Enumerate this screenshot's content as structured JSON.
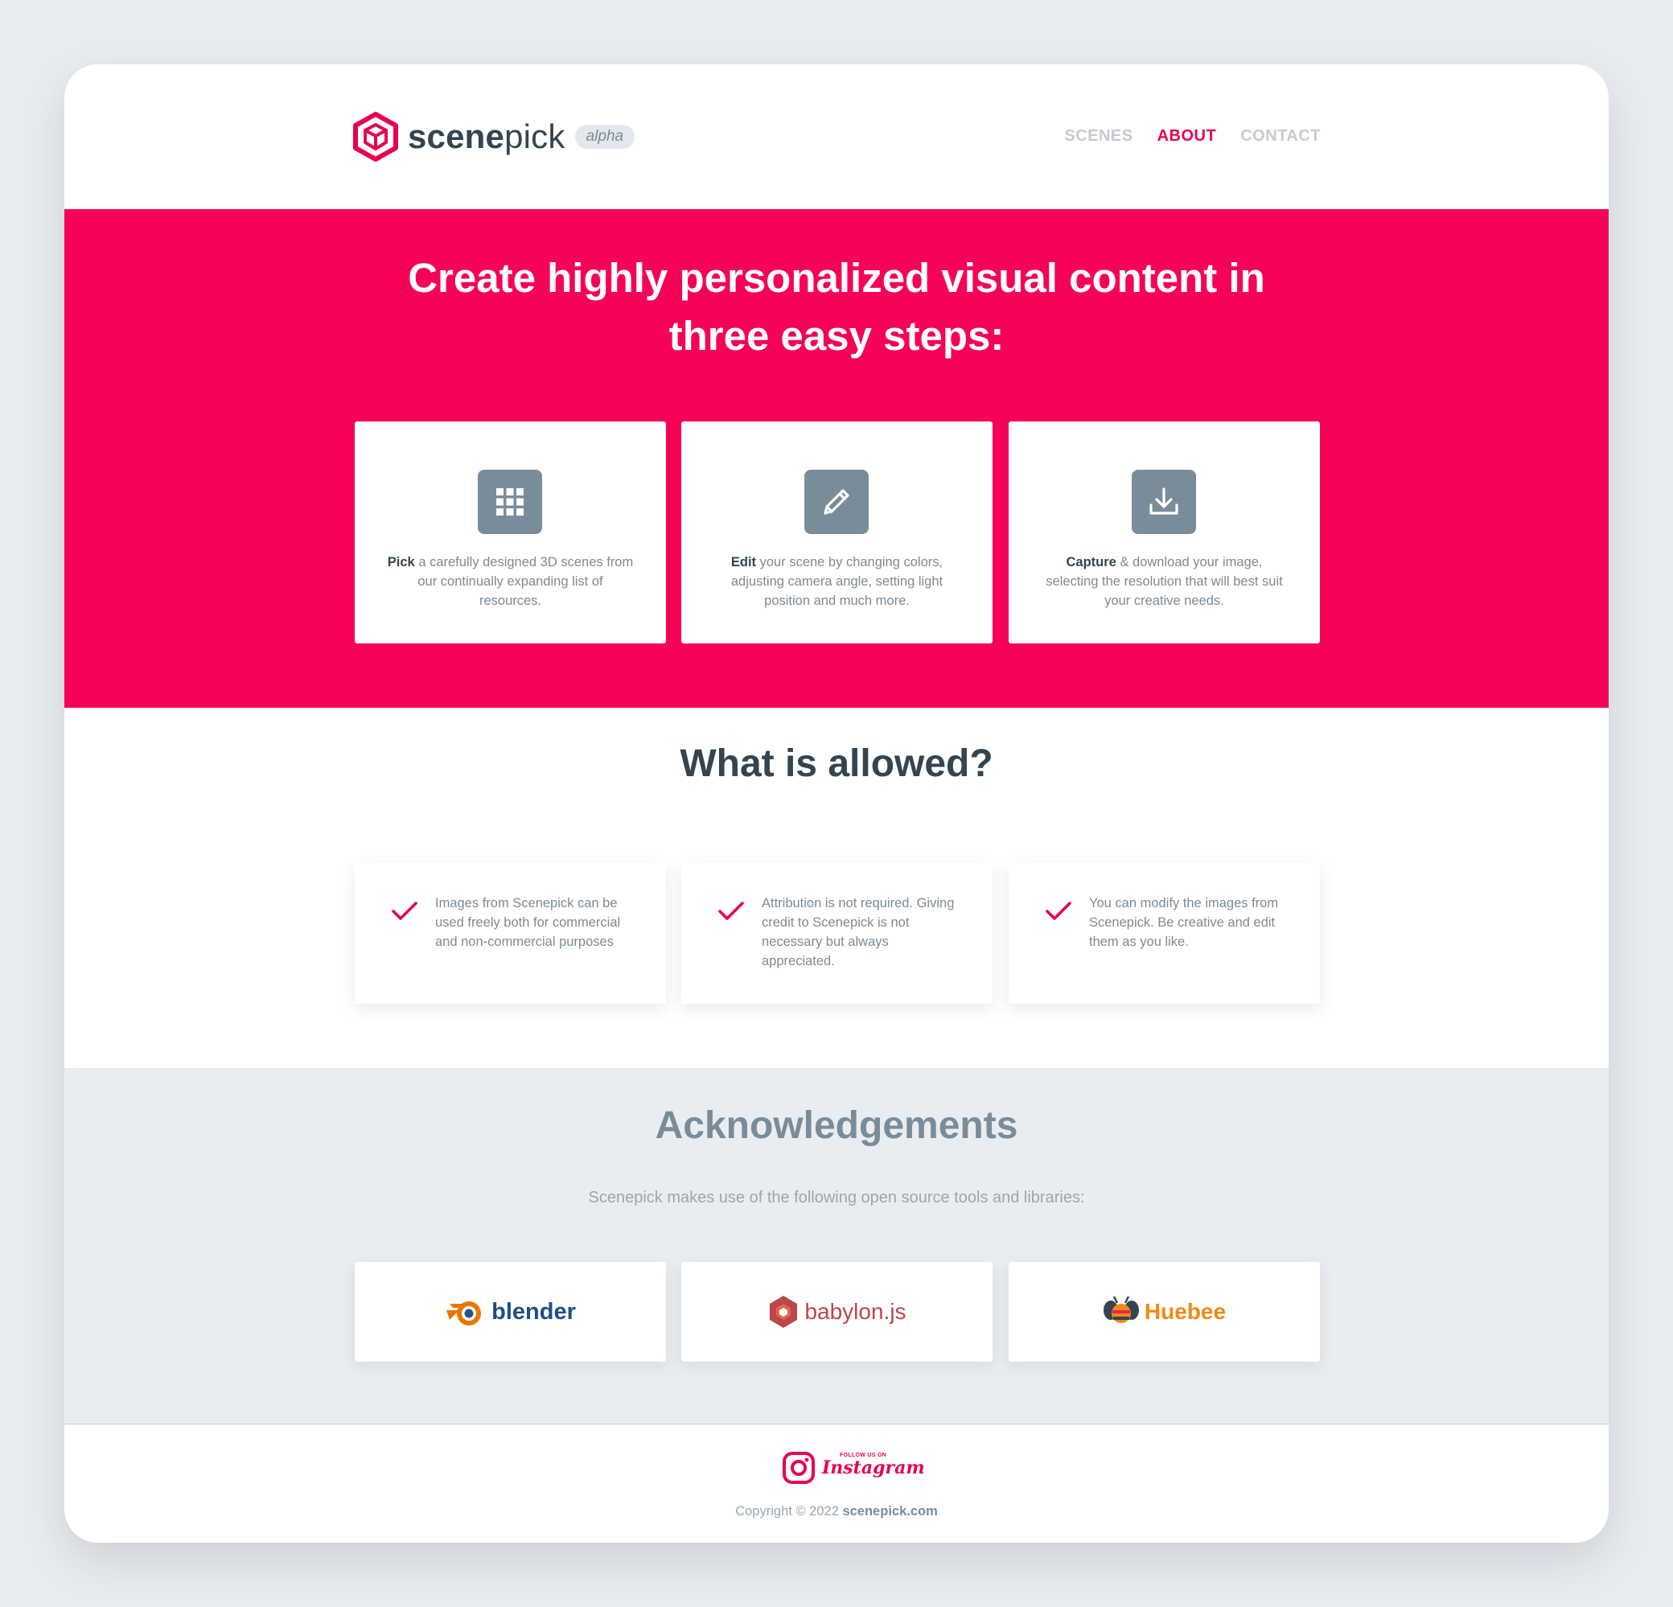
{
  "header": {
    "brand_bold": "scene",
    "brand_light": "pick",
    "badge": "alpha",
    "nav": [
      {
        "label": "SCENES",
        "active": false
      },
      {
        "label": "ABOUT",
        "active": true
      },
      {
        "label": "CONTACT",
        "active": false
      }
    ]
  },
  "hero": {
    "title_line1": "Create highly personalized visual content in",
    "title_line2": "three easy steps:",
    "steps": [
      {
        "icon": "grid-icon",
        "bold": "Pick",
        "text": " a carefully designed 3D scenes from our continually expanding list of resources."
      },
      {
        "icon": "pencil-icon",
        "bold": "Edit",
        "text": " your scene by changing colors, adjusting camera angle, setting light position and much more."
      },
      {
        "icon": "download-icon",
        "bold": "Capture",
        "text": " & download your image, selecting the resolution that will best suit your creative needs."
      }
    ]
  },
  "allowed": {
    "title": "What is allowed?",
    "items": [
      "Images from Scenepick can be used freely both for commercial and non-commercial purposes",
      "Attribution is not required. Giving credit to Scenepick is not necessary but always appreciated.",
      "You can modify the images from Scenepick. Be creative and edit them as you like."
    ]
  },
  "acknowledgements": {
    "title": "Acknowledgements",
    "subtitle": "Scenepick makes use of the following open source tools and libraries:",
    "libraries": [
      {
        "name": "blender",
        "icon": "blender-logo-icon",
        "color": "#1d4f83"
      },
      {
        "name": "babylon.js",
        "icon": "babylon-logo-icon",
        "color": "#bb464b"
      },
      {
        "name": "Huebee",
        "icon": "bee-logo-icon",
        "color": "#f08a14"
      }
    ]
  },
  "footer": {
    "follow": "FOLLOW US ON",
    "instagram": "Instagram",
    "copyright_prefix": "Copyright © 2022 ",
    "copyright_site": "scenepick.com"
  },
  "colors": {
    "accent": "#f50358",
    "nav_active": "#e8024f",
    "icon_bg": "#798c9a",
    "text_dark": "#344450",
    "page_bg": "#eaedf0"
  }
}
